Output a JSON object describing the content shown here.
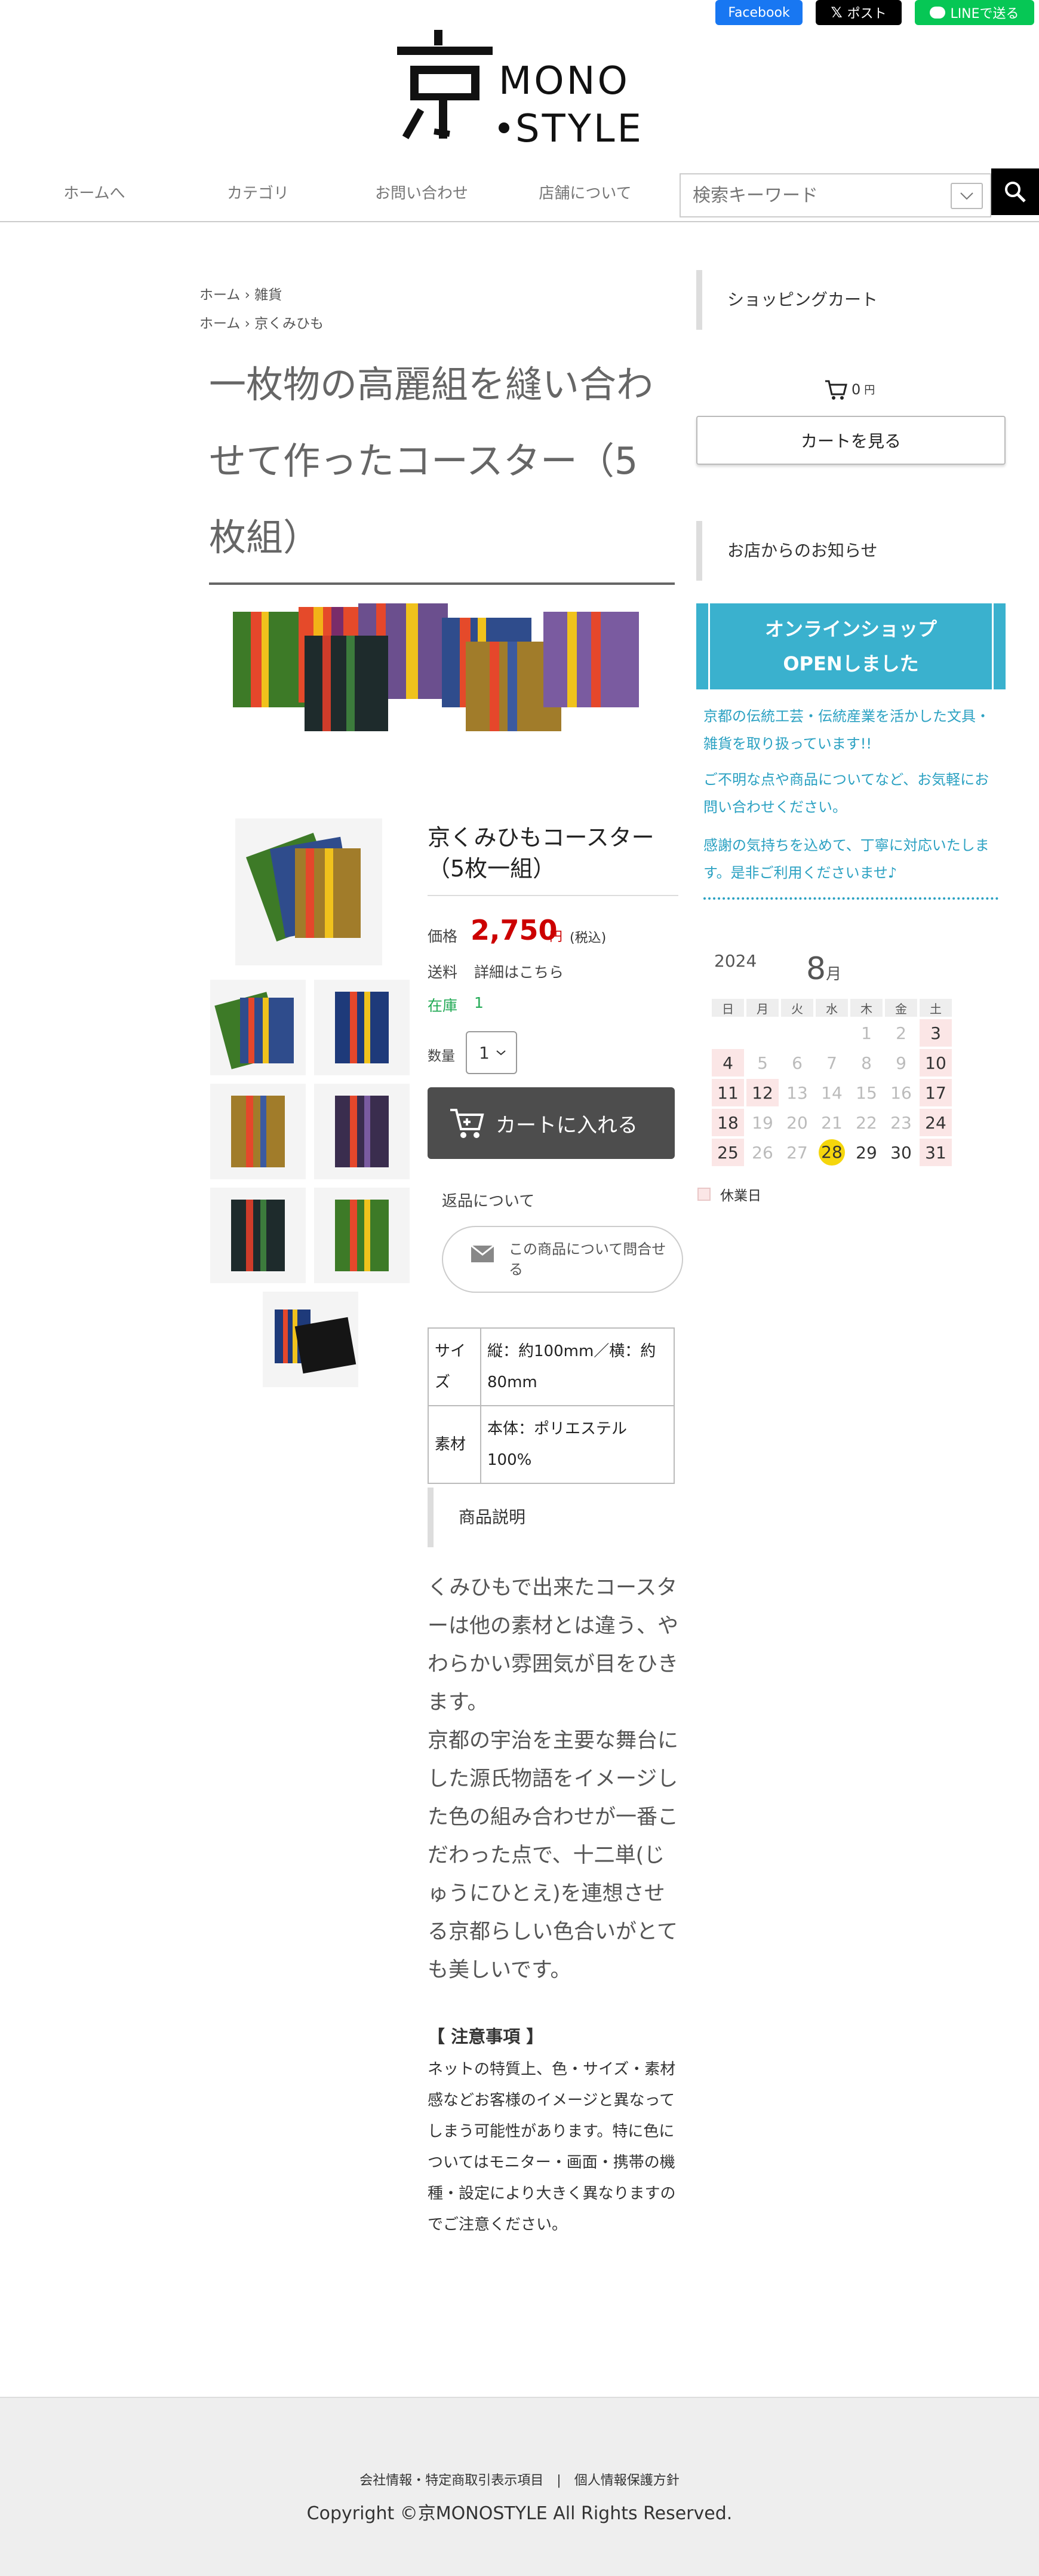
{
  "share": {
    "facebook": "Facebook",
    "x": "ポスト",
    "line": "LINEで送る"
  },
  "logo": {
    "mono": "MONO",
    "style": "STYLE"
  },
  "nav": {
    "items": [
      "ホームへ",
      "カテゴリ",
      "お問い合わせ",
      "店舗について"
    ],
    "search_placeholder": "検索キーワード"
  },
  "breadcrumbs": [
    {
      "home": "ホーム",
      "sep": "›",
      "cat": "雑貨"
    },
    {
      "home": "ホーム",
      "sep": "›",
      "cat": "京くみひも"
    }
  ],
  "product": {
    "title": "一枚物の高麗組を縫い合わせて作ったコースター（5枚組）",
    "name": "京くみひもコースター（5枚一組）",
    "price_label": "価格",
    "price": "2,750",
    "price_unit": "円",
    "price_tax": "(税込)",
    "shipping_label": "送料",
    "shipping_value": "詳細はこちら",
    "stock_label": "在庫",
    "stock_value": "1",
    "qty_label": "数量",
    "qty_value": "1",
    "cart_button": "カートに入れる",
    "returns": "返品について",
    "inquiry": "この商品について問合せる",
    "specs": [
      {
        "k": "サイズ",
        "v": "縦：約100mm／横：約80mm"
      },
      {
        "k": "素材",
        "v": "本体：ポリエステル100%"
      }
    ],
    "desc_heading": "商品説明",
    "description": "くみひもで出来たコースターは他の素材とは違う、やわらかい雰囲気が目をひきます。\n京都の宇治を主要な舞台にした源氏物語をイメージした色の組み合わせが一番こだわった点で、十二単(じゅうにひとえ)を連想させる京都らしい色合いがとても美しいです。",
    "notice_heading": "【 注意事項 】",
    "notice": "ネットの特質上、色・サイズ・素材感などお客様のイメージと異なってしまう可能性があります。特に色についてはモニター・画面・携帯の機種・設定により大きく異なりますのでご注意ください。"
  },
  "sidebar": {
    "cart_heading": "ショッピングカート",
    "cart_total": "0",
    "cart_unit": "円",
    "view_cart": "カートを見る",
    "news_heading": "お店からのお知らせ",
    "banner_line1": "オンラインショップ",
    "banner_line2": "OPENしました",
    "news": [
      "京都の伝統工芸・伝統産業を活かした文具・雑貨を取り扱っています!!",
      "ご不明な点や商品についてなど、お気軽にお問い合わせください。",
      "感謝の気持ちを込めて、丁寧に対応いたします。是非ご利用くださいませ♪"
    ]
  },
  "calendar": {
    "year": "2024",
    "month": "8",
    "month_unit": "月",
    "weekdays": [
      "日",
      "月",
      "火",
      "水",
      "木",
      "金",
      "土"
    ],
    "weeks": [
      [
        "",
        "",
        "",
        "",
        "1",
        "2",
        "3"
      ],
      [
        "4",
        "5",
        "6",
        "7",
        "8",
        "9",
        "10"
      ],
      [
        "11",
        "12",
        "13",
        "14",
        "15",
        "16",
        "17"
      ],
      [
        "18",
        "19",
        "20",
        "21",
        "22",
        "23",
        "24"
      ],
      [
        "25",
        "26",
        "27",
        "28",
        "29",
        "30",
        "31"
      ]
    ],
    "holidays": [
      "3",
      "4",
      "10",
      "11",
      "12",
      "17",
      "18",
      "24",
      "25",
      "31"
    ],
    "past_gray": [
      "1",
      "2",
      "5",
      "6",
      "7",
      "8",
      "9",
      "13",
      "14",
      "15",
      "16",
      "19",
      "20",
      "21",
      "22",
      "23",
      "26",
      "27"
    ],
    "today": "28",
    "legend": "休業日",
    "holiday_color": "#fbe6e6",
    "today_color": "#f5d60c"
  },
  "footer": {
    "links": "会社情報・特定商取引表示項目　|　個人情報保護方針",
    "copyright": "Copyright ©京MONOSTYLE All Rights Reserved."
  },
  "colors": {
    "accent": "#3ab1ce",
    "price": "#cc0000",
    "stock": "#22aa55"
  }
}
